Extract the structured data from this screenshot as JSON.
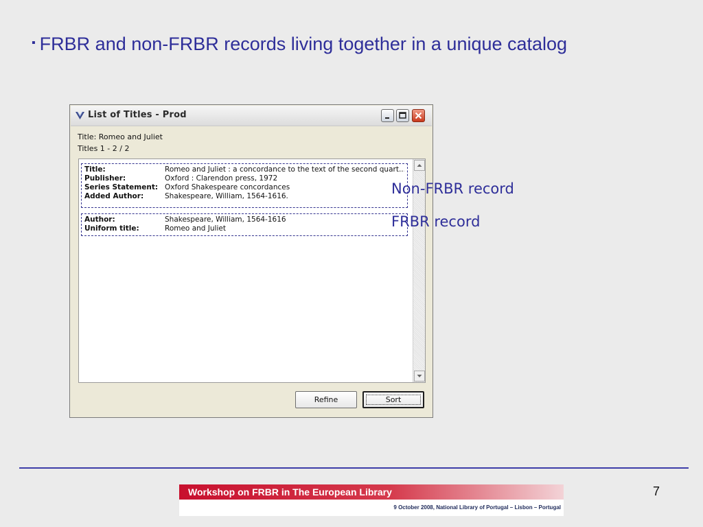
{
  "slide": {
    "bullet_symbol": "▪",
    "heading": "FRBR and non-FRBR records living together in a unique catalog",
    "page_number": "7"
  },
  "window": {
    "title": "List of Titles - Prod",
    "info_line1": "Title: Romeo and Juliet",
    "info_line2": "Titles 1 - 2 / 2",
    "records": [
      {
        "fields": [
          {
            "label": "Title:",
            "value": "Romeo and Juliet : a concordance to the text of the second quart..."
          },
          {
            "label": "Publisher:",
            "value": "Oxford : Clarendon press, 1972"
          },
          {
            "label": "Series Statement:",
            "value": "Oxford Shakespeare concordances"
          },
          {
            "label": "Added Author:",
            "value": "Shakespeare, William, 1564-1616."
          }
        ]
      },
      {
        "fields": [
          {
            "label": "Author:",
            "value": "Shakespeare, William, 1564-1616"
          },
          {
            "label": "Uniform title:",
            "value": "Romeo and Juliet"
          }
        ]
      }
    ],
    "buttons": {
      "refine": "Refine",
      "sort": "Sort"
    }
  },
  "annotations": {
    "non_frbr": "Non-FRBR record",
    "frbr": "FRBR record"
  },
  "footer": {
    "title": "Workshop on FRBR in The European Library",
    "subtitle": "9 October 2008, National Library of Portugal – Lisbon – Portugal"
  },
  "colors": {
    "heading_text": "#2e2e99",
    "record_border": "#33338f",
    "footer_red": "#c8102e",
    "divider": "#3c3ca8"
  },
  "icons": {
    "window_icon": "chevron-shield-icon",
    "minimize": "minimize-icon",
    "maximize": "maximize-icon",
    "close": "close-icon",
    "scroll_up": "arrow-up-icon",
    "scroll_down": "arrow-down-icon"
  }
}
